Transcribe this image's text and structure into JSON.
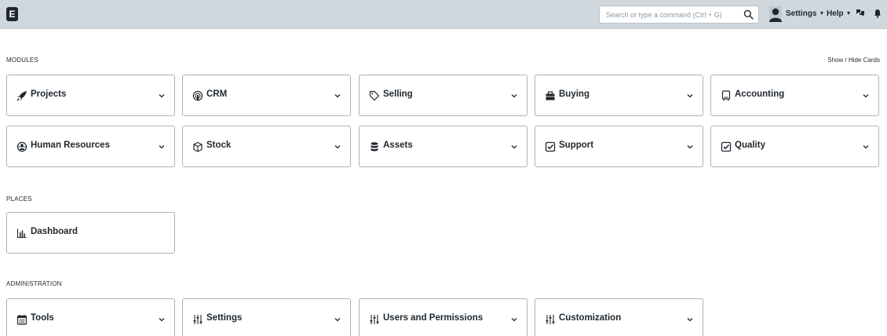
{
  "navbar": {
    "logo_letter": "E",
    "search_placeholder": "Search or type a command (Ctrl + G)",
    "settings_label": "Settings",
    "help_label": "Help"
  },
  "sections": {
    "modules_label": "MODULES",
    "show_hide_label": "Show / Hide Cards",
    "places_label": "PLACES",
    "administration_label": "ADMINISTRATION"
  },
  "modules": [
    {
      "label": "Projects",
      "icon": "rocket-icon"
    },
    {
      "label": "CRM",
      "icon": "crm-icon"
    },
    {
      "label": "Selling",
      "icon": "tag-icon"
    },
    {
      "label": "Buying",
      "icon": "briefcase-icon"
    },
    {
      "label": "Accounting",
      "icon": "book-icon"
    },
    {
      "label": "Human Resources",
      "icon": "users-icon"
    },
    {
      "label": "Stock",
      "icon": "box-icon"
    },
    {
      "label": "Assets",
      "icon": "database-icon"
    },
    {
      "label": "Support",
      "icon": "check-square-icon"
    },
    {
      "label": "Quality",
      "icon": "check-square-icon"
    }
  ],
  "places": [
    {
      "label": "Dashboard",
      "icon": "bar-chart-icon"
    }
  ],
  "administration": [
    {
      "label": "Tools",
      "icon": "calendar-icon"
    },
    {
      "label": "Settings",
      "icon": "sliders-icon"
    },
    {
      "label": "Users and Permissions",
      "icon": "sliders-icon"
    },
    {
      "label": "Customization",
      "icon": "sliders-icon"
    }
  ]
}
